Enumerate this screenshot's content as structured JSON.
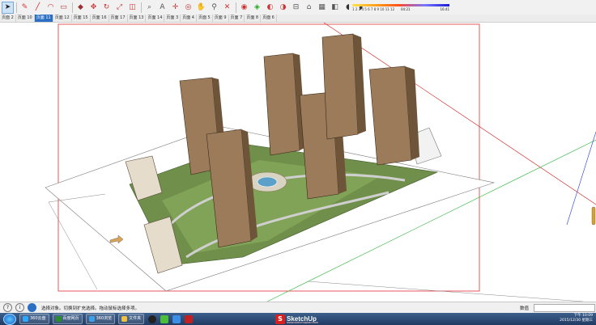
{
  "toolbar": {
    "tools": [
      "select-arrow",
      "eraser",
      "pencil-line",
      "arc",
      "shape",
      "push-pull",
      "move",
      "rotate",
      "scale",
      "offset",
      "tape-measure",
      "text",
      "axes",
      "orbit",
      "pan",
      "zoom",
      "zoom-extents",
      "paint-bucket",
      "component",
      "section",
      "shadow",
      "style",
      "x-ray",
      "materials",
      "fog"
    ],
    "scale_numbers": "1 2 3 4 5 6 7 8 9 10 11 12",
    "scale_low": "04:21",
    "scale_high": "16:41"
  },
  "tabs": [
    "页面 2",
    "页面 10",
    "页面 11",
    "页面 12",
    "页面 15",
    "页面 16",
    "页面 17",
    "页面 13",
    "页面 14",
    "页面 3",
    "页面 4",
    "页面 5",
    "页面 9",
    "页面 7",
    "页面 8",
    "页面 6"
  ],
  "active_tab_index": 2,
  "status": {
    "message": "选择对象。切换到扩充选择。拖动鼠标选择多项。",
    "vcb_label": "数值",
    "vcb_value": ""
  },
  "taskbar": {
    "items": [
      {
        "label": "360云盘",
        "color": "#2fa7ff"
      },
      {
        "label": "百度网页",
        "color": "#2a8c2a"
      },
      {
        "label": "360浏览",
        "color": "#3ba0ea"
      },
      {
        "label": "文件夹",
        "color": "#f0c040"
      }
    ],
    "brand": "SketchUp",
    "brand_letter": "S",
    "brand_sub": "www.sketchupbar.com",
    "clock_time": "下午 10:09",
    "clock_date": "2015/12/30 星期三"
  },
  "colors": {
    "frame": "#e65a5a",
    "axis_red": "#d41a1a",
    "axis_green": "#2db83a",
    "axis_blue": "#1a3ad6",
    "ground": "#6f8f4a",
    "tower": "#9b7b5a"
  }
}
